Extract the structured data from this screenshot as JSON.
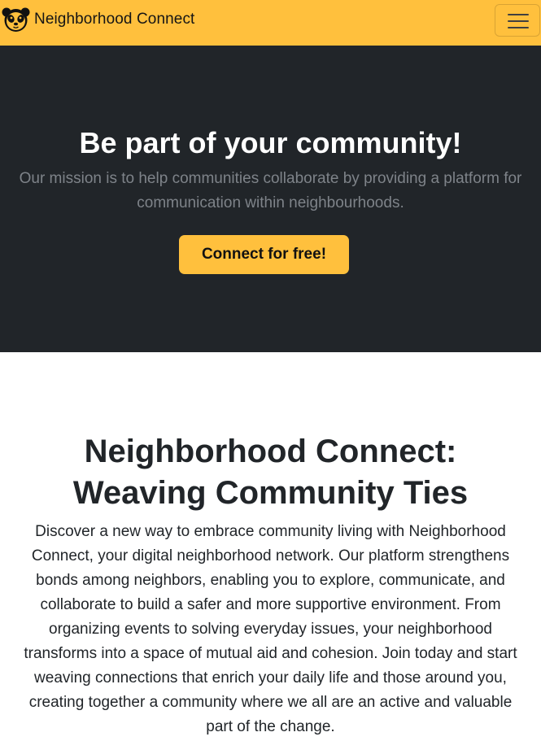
{
  "navbar": {
    "brand_name": "Neighborhood Connect",
    "logo_icon": "panda-face-icon",
    "menu_icon": "hamburger-menu-icon",
    "background_color": "#ffc03d"
  },
  "hero": {
    "title": "Be part of your community!",
    "lead": "Our mission is to help communities collaborate by providing a platform for communication within neighbourhoods.",
    "cta_label": "Connect for free!",
    "background_color": "#212529",
    "cta_color": "#ffc03d"
  },
  "about": {
    "title": "Neighborhood Connect: Weaving Community Ties",
    "text": "Discover a new way to embrace community living with Neighborhood Connect, your digital neighborhood network. Our platform strengthens bonds among neighbors, enabling you to explore, communicate, and collaborate to build a safer and more supportive environment. From organizing events to solving everyday issues, your neighborhood transforms into a space of mutual aid and cohesion. Join today and start weaving connections that enrich your daily life and those around you, creating together a community where we all are an active and valuable part of the change."
  }
}
